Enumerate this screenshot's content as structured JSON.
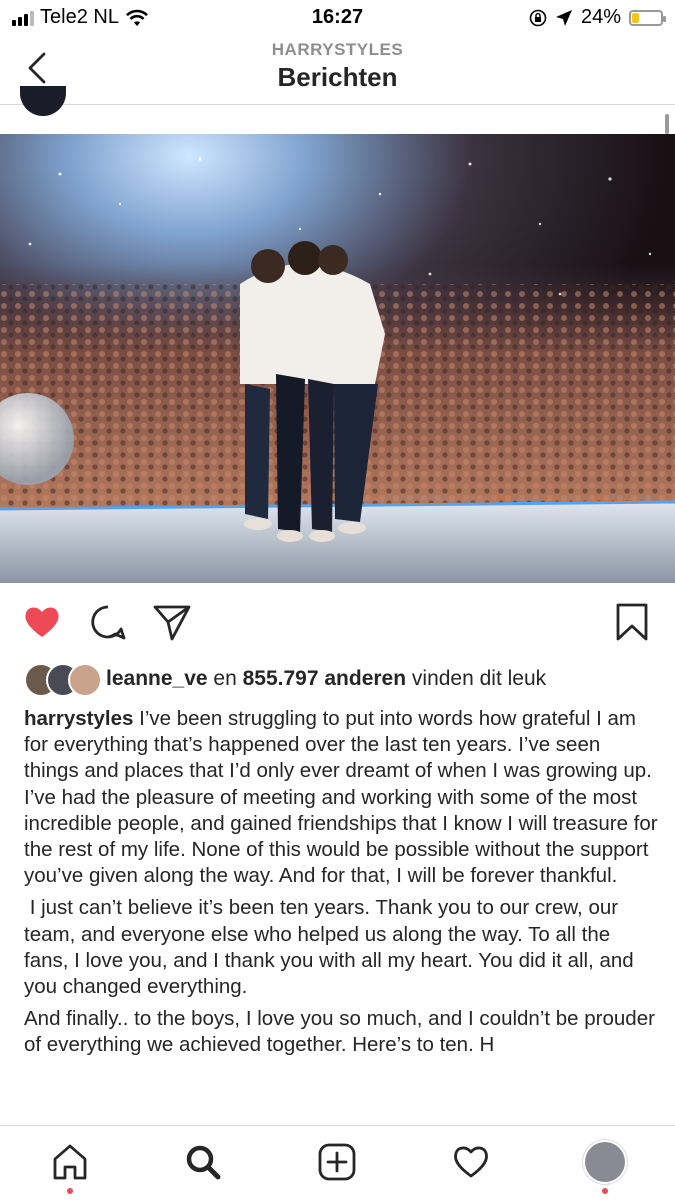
{
  "status_bar": {
    "carrier": "Tele2 NL",
    "time": "16:27",
    "battery_percent_label": "24%",
    "battery_level": 0.24,
    "battery_color": "#f5c518"
  },
  "header": {
    "subtitle": "HARRYSTYLES",
    "title": "Berichten",
    "back_icon": "chevron-left-icon"
  },
  "post": {
    "photo_description_icon": "concert-photo",
    "actions": {
      "like_icon": "heart-filled-icon",
      "like_color": "#ed4956",
      "comment_icon": "comment-icon",
      "share_icon": "paper-plane-icon",
      "save_icon": "bookmark-icon"
    },
    "likes": {
      "user": "leanne_ve",
      "connector": "en",
      "count_text": "855.797 anderen",
      "suffix": "vinden dit leuk"
    },
    "caption": {
      "username": "harrystyles",
      "paragraph1": "I’ve been struggling to put into words how grateful I am for everything that’s happened over the last ten years. I’ve seen things and places that I’d only ever dreamt of when I was growing up. I’ve had the pleasure of meeting and working with some of the most incredible people, and gained friendships that I know I will treasure for the rest of my life. None of this would be possible without the support you’ve given along the way. And for that, I will be forever thankful.",
      "paragraph2": " I just can’t believe it’s been ten years. Thank you to our crew, our team, and everyone else who helped us along the way. To all the fans, I love you, and I thank you with all my heart. You did it all, and you changed everything.",
      "paragraph3": "And finally.. to the boys, I love you so much, and I couldn’t be prouder of everything we achieved together. Here’s to ten. H"
    }
  },
  "tab_bar": {
    "items": [
      {
        "icon": "home-icon",
        "active": false,
        "dot": true
      },
      {
        "icon": "search-icon",
        "active": true,
        "dot": false
      },
      {
        "icon": "add-post-icon",
        "active": false,
        "dot": false
      },
      {
        "icon": "activity-heart-icon",
        "active": false,
        "dot": false
      },
      {
        "icon": "profile-avatar",
        "active": false,
        "dot": true
      }
    ],
    "dot_color": "#ed4956"
  }
}
